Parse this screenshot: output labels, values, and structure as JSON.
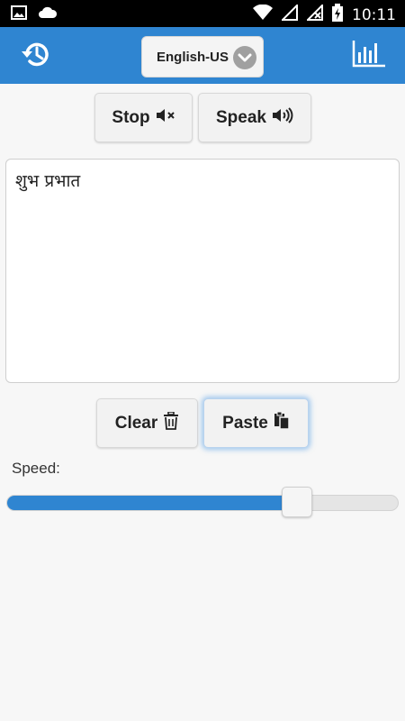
{
  "status_bar": {
    "time": "10:11",
    "left_icons": [
      "image-icon",
      "cloud-icon"
    ],
    "right_icons": [
      "wifi-icon",
      "signal-icon",
      "no-sim-icon",
      "battery-charging-icon"
    ]
  },
  "header": {
    "history_icon": "history-icon",
    "language": "English-US",
    "chevron_icon": "chevron-down-icon",
    "stats_icon": "bar-chart-icon",
    "accent_color": "#2f85d1"
  },
  "controls": {
    "stop_label": "Stop",
    "stop_icon": "volume-mute-icon",
    "speak_label": "Speak",
    "speak_icon": "volume-up-icon"
  },
  "editor": {
    "text": "शुभ प्रभात"
  },
  "actions": {
    "clear_label": "Clear",
    "clear_icon": "trash-icon",
    "paste_label": "Paste",
    "paste_icon": "clipboard-icon"
  },
  "speed": {
    "label": "Speed:",
    "value": 0.74
  }
}
